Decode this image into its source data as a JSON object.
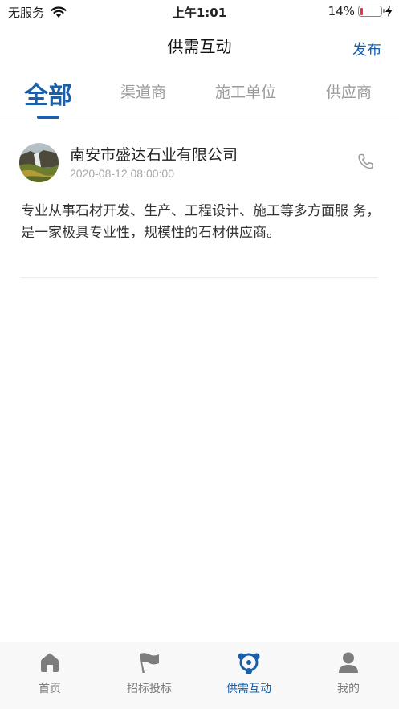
{
  "status_bar": {
    "carrier": "无服务",
    "time": "上午1:01",
    "battery_text": "14%",
    "battery_level": 0.14
  },
  "nav": {
    "title": "供需互动",
    "action_label": "发布"
  },
  "tabs": [
    {
      "label": "全部",
      "active": true
    },
    {
      "label": "渠道商",
      "active": false
    },
    {
      "label": "施工单位",
      "active": false
    },
    {
      "label": "供应商",
      "active": false
    }
  ],
  "posts": [
    {
      "company": "南安市盛达石业有限公司",
      "time": "2020-08-12 08:00:00",
      "description": "专业从事石材开发、生产、工程设计、施工等多方面服 务，是一家极具专业性，规模性的石材供应商。"
    }
  ],
  "bottom_tabs": [
    {
      "label": "首页",
      "icon": "home-icon",
      "active": false
    },
    {
      "label": "招标投标",
      "icon": "flag-icon",
      "active": false
    },
    {
      "label": "供需互动",
      "icon": "share-nodes-icon",
      "active": true
    },
    {
      "label": "我的",
      "icon": "user-icon",
      "active": false
    }
  ],
  "colors": {
    "accent": "#1a5fa8",
    "inactive_text": "#9a9a9a",
    "battery_low": "#e53935"
  }
}
